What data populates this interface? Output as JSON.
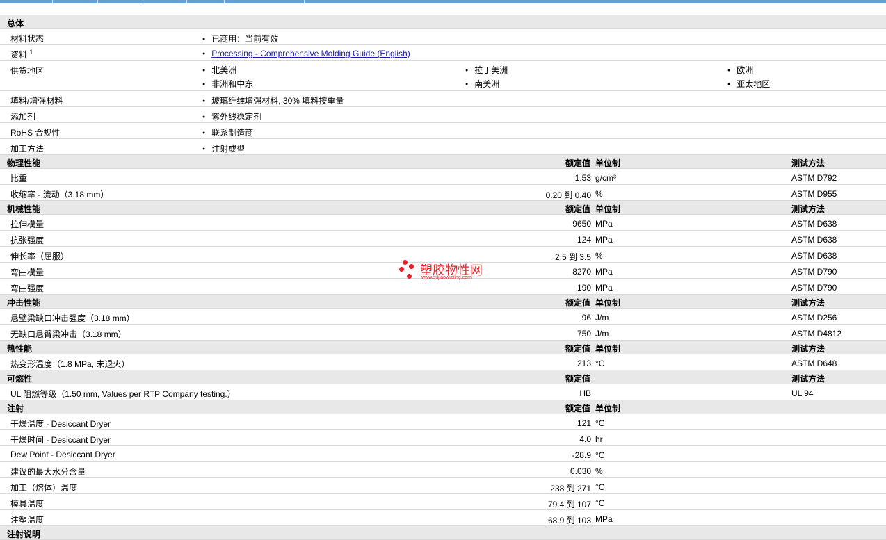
{
  "general": {
    "title": "总体",
    "status_label": "材料状态",
    "status_value": "已商用：当前有效",
    "docs_label": "资料",
    "docs_sup": "1",
    "docs_link": "Processing - Comprehensive Molding Guide (English)",
    "regions_label": "供货地区",
    "regions": [
      "北美洲",
      "拉丁美洲",
      "欧洲",
      "非洲和中东",
      "南美洲",
      "亚太地区"
    ],
    "filler_label": "填料/增强材料",
    "filler_value": "玻璃纤维增强材料, 30% 填料按重量",
    "additive_label": "添加剂",
    "additive_value": "紫外线稳定剂",
    "rohs_label": "RoHS 合规性",
    "rohs_value": "联系制造商",
    "process_label": "加工方法",
    "process_value": "注射成型"
  },
  "headers": {
    "nominal": "额定值",
    "unit": "单位制",
    "test": "测试方法"
  },
  "sections": [
    {
      "title": "物理性能",
      "show_unit": true,
      "show_test": true,
      "rows": [
        {
          "label": "比重",
          "value": "1.53",
          "unit": "g/cm³",
          "test": "ASTM D792"
        },
        {
          "label": "收缩率 - 流动（3.18 mm）",
          "value": "0.20 到  0.40",
          "unit": "%",
          "test": "ASTM D955"
        }
      ]
    },
    {
      "title": "机械性能",
      "show_unit": true,
      "show_test": true,
      "rows": [
        {
          "label": "拉伸模量",
          "value": "9650",
          "unit": "MPa",
          "test": "ASTM D638"
        },
        {
          "label": "抗张强度",
          "value": "124",
          "unit": "MPa",
          "test": "ASTM D638"
        },
        {
          "label": "伸长率（屈服）",
          "value": "2.5 到  3.5",
          "unit": "%",
          "test": "ASTM D638"
        },
        {
          "label": "弯曲模量",
          "value": "8270",
          "unit": "MPa",
          "test": "ASTM D790"
        },
        {
          "label": "弯曲强度",
          "value": "190",
          "unit": "MPa",
          "test": "ASTM D790"
        }
      ]
    },
    {
      "title": "冲击性能",
      "show_unit": true,
      "show_test": true,
      "rows": [
        {
          "label": "悬壁梁缺口冲击强度（3.18 mm）",
          "value": "96",
          "unit": "J/m",
          "test": "ASTM D256"
        },
        {
          "label": "无缺口悬臂梁冲击（3.18 mm）",
          "value": "750",
          "unit": "J/m",
          "test": "ASTM D4812"
        }
      ]
    },
    {
      "title": "热性能",
      "show_unit": true,
      "show_test": true,
      "rows": [
        {
          "label": "热变形温度（1.8 MPa, 未退火）",
          "value": "213",
          "unit": "°C",
          "test": "ASTM D648"
        }
      ]
    },
    {
      "title": "可燃性",
      "show_unit": false,
      "show_test": true,
      "rows": [
        {
          "label": "UL 阻燃等级（1.50 mm, Values per RTP Company testing.）",
          "value": "HB",
          "unit": "",
          "test": "UL 94"
        }
      ]
    },
    {
      "title": "注射",
      "show_unit": true,
      "show_test": false,
      "rows": [
        {
          "label": "干燥温度  - Desiccant Dryer",
          "value": "121",
          "unit": "°C",
          "test": ""
        },
        {
          "label": "干燥时间  - Desiccant Dryer",
          "value": "4.0",
          "unit": "hr",
          "test": ""
        },
        {
          "label": "Dew Point - Desiccant Dryer",
          "value": "-28.9",
          "unit": "°C",
          "test": ""
        },
        {
          "label": "建议的最大水分含量",
          "value": "0.030",
          "unit": "%",
          "test": ""
        },
        {
          "label": "加工（熔体）温度",
          "value": "238 到  271",
          "unit": "°C",
          "test": ""
        },
        {
          "label": "模具温度",
          "value": "79.4 到  107",
          "unit": "°C",
          "test": ""
        },
        {
          "label": "注塑温度",
          "value": "68.9 到  103",
          "unit": "MPa",
          "test": ""
        }
      ]
    },
    {
      "title": "注射说明",
      "show_nominal": false,
      "show_unit": false,
      "show_test": false,
      "rows": []
    }
  ],
  "watermark": {
    "title": "塑胶物性网",
    "url": "www.sujiaowuxing.com"
  }
}
